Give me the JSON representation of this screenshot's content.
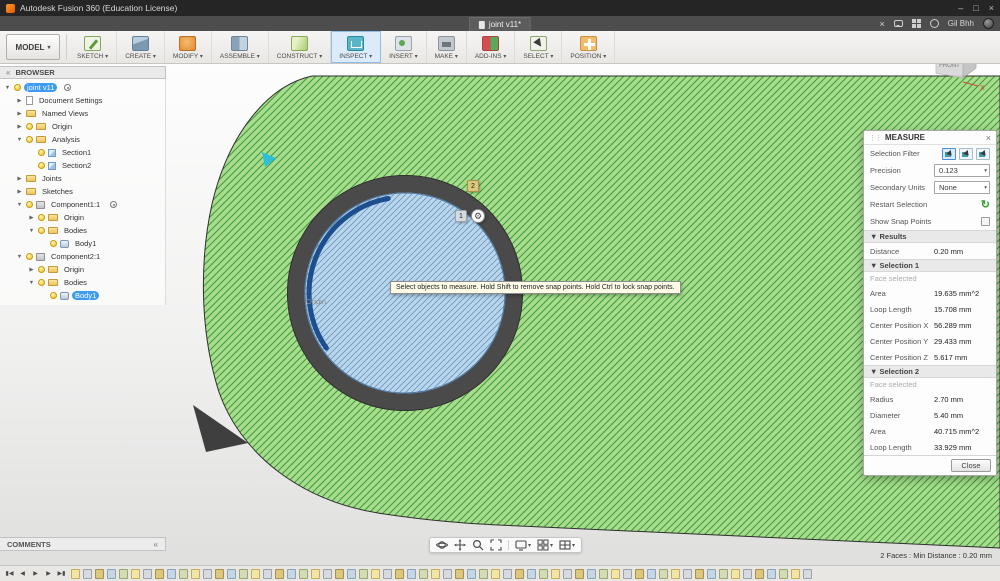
{
  "titlebar": {
    "title": "Autodesk Fusion 360 (Education License)"
  },
  "tabbar": {
    "document_tab": "joint v11*",
    "user_name": "Gil Bhh"
  },
  "toolbar": {
    "workspace_label": "MODEL",
    "groups": [
      {
        "id": "sketch",
        "label": "SKETCH"
      },
      {
        "id": "create",
        "label": "CREATE"
      },
      {
        "id": "modify",
        "label": "MODIFY"
      },
      {
        "id": "assemble",
        "label": "ASSEMBLE"
      },
      {
        "id": "construct",
        "label": "CONSTRUCT"
      },
      {
        "id": "inspect",
        "label": "INSPECT",
        "active": true
      },
      {
        "id": "insert",
        "label": "INSERT"
      },
      {
        "id": "make",
        "label": "MAKE"
      },
      {
        "id": "addins",
        "label": "ADD-INS"
      },
      {
        "id": "select",
        "label": "SELECT"
      },
      {
        "id": "position",
        "label": "POSITION"
      }
    ]
  },
  "browser": {
    "header": "BROWSER",
    "items": [
      {
        "label": "joint v11",
        "depth": 0,
        "arrow": "down",
        "icons": [
          "bulb"
        ],
        "pill": true,
        "trailing": "radio"
      },
      {
        "label": "Document Settings",
        "depth": 1,
        "arrow": "right",
        "icons": [
          "doc"
        ]
      },
      {
        "label": "Named Views",
        "depth": 1,
        "arrow": "right",
        "icons": [
          "folder"
        ]
      },
      {
        "label": "Origin",
        "depth": 1,
        "arrow": "right",
        "icons": [
          "bulb",
          "folder"
        ]
      },
      {
        "label": "Analysis",
        "depth": 1,
        "arrow": "down",
        "icons": [
          "bulb",
          "folder"
        ]
      },
      {
        "label": "Section1",
        "depth": 2,
        "arrow": "none",
        "icons": [
          "bulb",
          "section"
        ]
      },
      {
        "label": "Section2",
        "depth": 2,
        "arrow": "none",
        "icons": [
          "bulb",
          "section"
        ]
      },
      {
        "label": "Joints",
        "depth": 1,
        "arrow": "right",
        "icons": [
          "folder"
        ]
      },
      {
        "label": "Sketches",
        "depth": 1,
        "arrow": "right",
        "icons": [
          "folder"
        ]
      },
      {
        "label": "Component1:1",
        "depth": 1,
        "arrow": "down",
        "icons": [
          "bulb",
          "component"
        ],
        "trailing": "radio"
      },
      {
        "label": "Origin",
        "depth": 2,
        "arrow": "right",
        "icons": [
          "bulb",
          "folder"
        ]
      },
      {
        "label": "Bodies",
        "depth": 2,
        "arrow": "down",
        "icons": [
          "bulb",
          "folder"
        ]
      },
      {
        "label": "Body1",
        "depth": 3,
        "arrow": "none",
        "icons": [
          "bulb",
          "body"
        ]
      },
      {
        "label": "Component2:1",
        "depth": 1,
        "arrow": "down",
        "icons": [
          "bulb",
          "component"
        ]
      },
      {
        "label": "Origin",
        "depth": 2,
        "arrow": "right",
        "icons": [
          "bulb",
          "folder"
        ]
      },
      {
        "label": "Bodies",
        "depth": 2,
        "arrow": "down",
        "icons": [
          "bulb",
          "folder"
        ]
      },
      {
        "label": "Body1",
        "depth": 3,
        "arrow": "none",
        "icons": [
          "bulb",
          "body"
        ],
        "selected": true
      }
    ]
  },
  "measure": {
    "title": "MEASURE",
    "selection_filter_label": "Selection Filter",
    "selection_filter_icons": [
      "select-faces",
      "select-bodies",
      "select-components"
    ],
    "precision_label": "Precision",
    "precision_value": "0.123",
    "secondary_units_label": "Secondary Units",
    "secondary_units_value": "None",
    "restart_label": "Restart Selection",
    "snap_label": "Show Snap Points",
    "sections": [
      {
        "header": "Results",
        "rows": [
          {
            "label": "Distance",
            "value": "0.20 mm"
          }
        ]
      },
      {
        "header": "Selection 1",
        "note": "Face selected",
        "rows": [
          {
            "label": "Area",
            "value": "19.635 mm^2"
          },
          {
            "label": "Loop Length",
            "value": "15.708 mm"
          },
          {
            "label": "Center Position X",
            "value": "56.289 mm"
          },
          {
            "label": "Center Position Y",
            "value": "29.433 mm"
          },
          {
            "label": "Center Position Z",
            "value": "5.617 mm"
          }
        ]
      },
      {
        "header": "Selection 2",
        "note": "Face selected",
        "rows": [
          {
            "label": "Radius",
            "value": "2.70 mm"
          },
          {
            "label": "Diameter",
            "value": "5.40 mm"
          },
          {
            "label": "Area",
            "value": "40.715 mm^2"
          },
          {
            "label": "Loop Length",
            "value": "33.929 mm"
          }
        ]
      }
    ],
    "close_label": "Close"
  },
  "canvas": {
    "tooltip": "Select objects to measure. Hold Shift to remove snap points. Hold Ctrl to lock snap points.",
    "origin_label": "Origin",
    "marker_1": "1",
    "marker_2": "2",
    "viewcube_front": "FRONT",
    "axis_x": "X",
    "axis_z": "Z",
    "status_text": "2 Faces : Min Distance : 0.20 mm",
    "colors": {
      "section_fill": "#a9dc8d",
      "section_hatch": "#3f9e3f",
      "hole_fill": "#b9d6ec",
      "hole_hatch": "#6f98c0",
      "ring": "#4a4a4a",
      "edge_highlight": "#1d4f8f",
      "selection_blue": "#3d9bf0"
    }
  },
  "comments": {
    "header": "COMMENTS"
  },
  "navbar": {
    "icons": [
      "orbit",
      "pan",
      "zoom",
      "fit",
      "display-settings",
      "grid-and-snaps",
      "viewports"
    ]
  },
  "timeline": {
    "playback": [
      {
        "name": "go-to-start",
        "glyph": "▮◀"
      },
      {
        "name": "step-back",
        "glyph": "◀"
      },
      {
        "name": "play",
        "glyph": "▶"
      },
      {
        "name": "step-forward",
        "glyph": "▶"
      },
      {
        "name": "go-to-end",
        "glyph": "▶▮"
      }
    ],
    "feature_marker_count": 62
  }
}
